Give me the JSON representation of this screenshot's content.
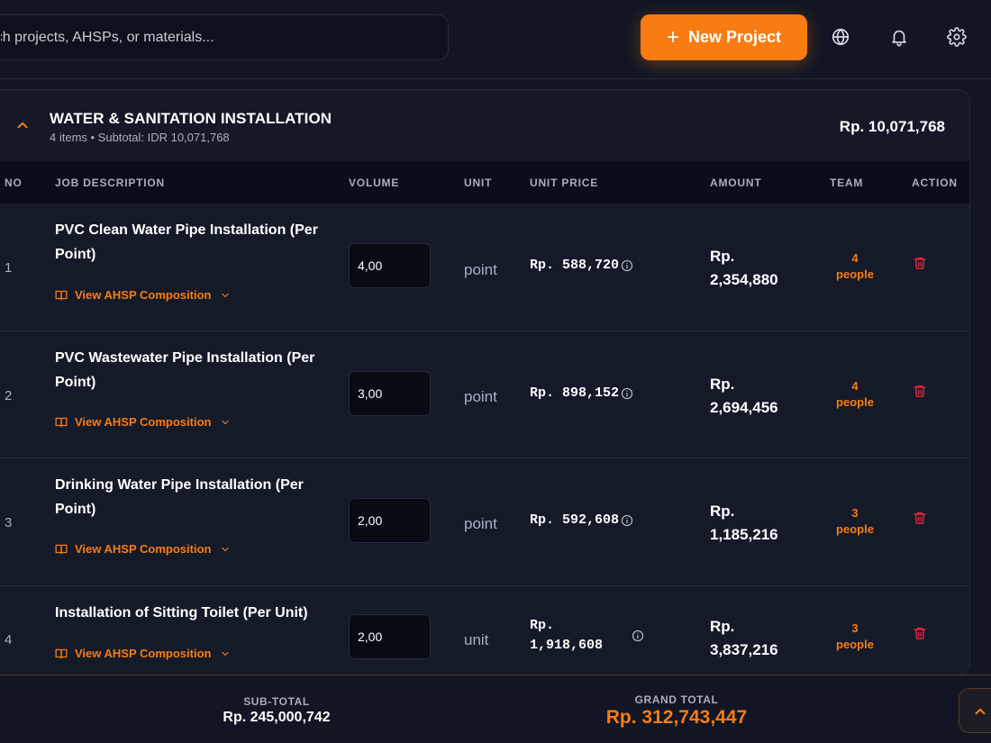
{
  "header": {
    "search_placeholder": "Search projects, AHSPs, or materials...",
    "new_project_label": "New Project",
    "new_project_icon": "plus-icon",
    "icons": [
      "globe-icon",
      "bell-icon",
      "gear-icon"
    ]
  },
  "section": {
    "title": "WATER & SANITATION INSTALLATION",
    "subtitle": "4 items • Subtotal: IDR 10,071,768",
    "total": "Rp. 10,071,768"
  },
  "table": {
    "headers": {
      "no": "NO",
      "description": "JOB DESCRIPTION",
      "volume": "VOLUME",
      "unit": "UNIT",
      "unit_price": "UNIT PRICE",
      "amount": "AMOUNT",
      "team": "TEAM",
      "action": "ACTION"
    },
    "ahsp_link_label": "View AHSP Composition",
    "rows": [
      {
        "no": "1",
        "desc_line1": "PVC Clean Water Pipe Installation (Per",
        "desc_line2": "Point)",
        "volume": "4,00",
        "unit": "point",
        "price_line1": "Rp. 588,720",
        "price_line2": "",
        "amount_line1": "Rp.",
        "amount_line2": "2,354,880",
        "team_count": "4",
        "team_label": "people"
      },
      {
        "no": "2",
        "desc_line1": "PVC Wastewater Pipe Installation (Per",
        "desc_line2": "Point)",
        "volume": "3,00",
        "unit": "point",
        "price_line1": "Rp. 898,152",
        "price_line2": "",
        "amount_line1": "Rp.",
        "amount_line2": "2,694,456",
        "team_count": "4",
        "team_label": "people"
      },
      {
        "no": "3",
        "desc_line1": "Drinking Water Pipe Installation (Per",
        "desc_line2": "Point)",
        "volume": "2,00",
        "unit": "point",
        "price_line1": "Rp. 592,608",
        "price_line2": "",
        "amount_line1": "Rp.",
        "amount_line2": "1,185,216",
        "team_count": "3",
        "team_label": "people"
      },
      {
        "no": "4",
        "desc_line1": "Installation of Sitting Toilet (Per Unit)",
        "desc_line2": "",
        "volume": "2,00",
        "unit": "unit",
        "price_line1": "Rp.",
        "price_line2": "1,918,608",
        "amount_line1": "Rp.",
        "amount_line2": "3,837,216",
        "team_count": "3",
        "team_label": "people"
      }
    ]
  },
  "footer": {
    "subtotal_label": "SUB-TOTAL",
    "subtotal_value": "Rp. 245,000,742",
    "grand_total_label": "GRAND TOTAL",
    "grand_total_value": "Rp. 312,743,447"
  },
  "colors": {
    "accent": "#f97c12",
    "danger": "#e0243a",
    "background": "#121624",
    "panel": "#151a29"
  }
}
